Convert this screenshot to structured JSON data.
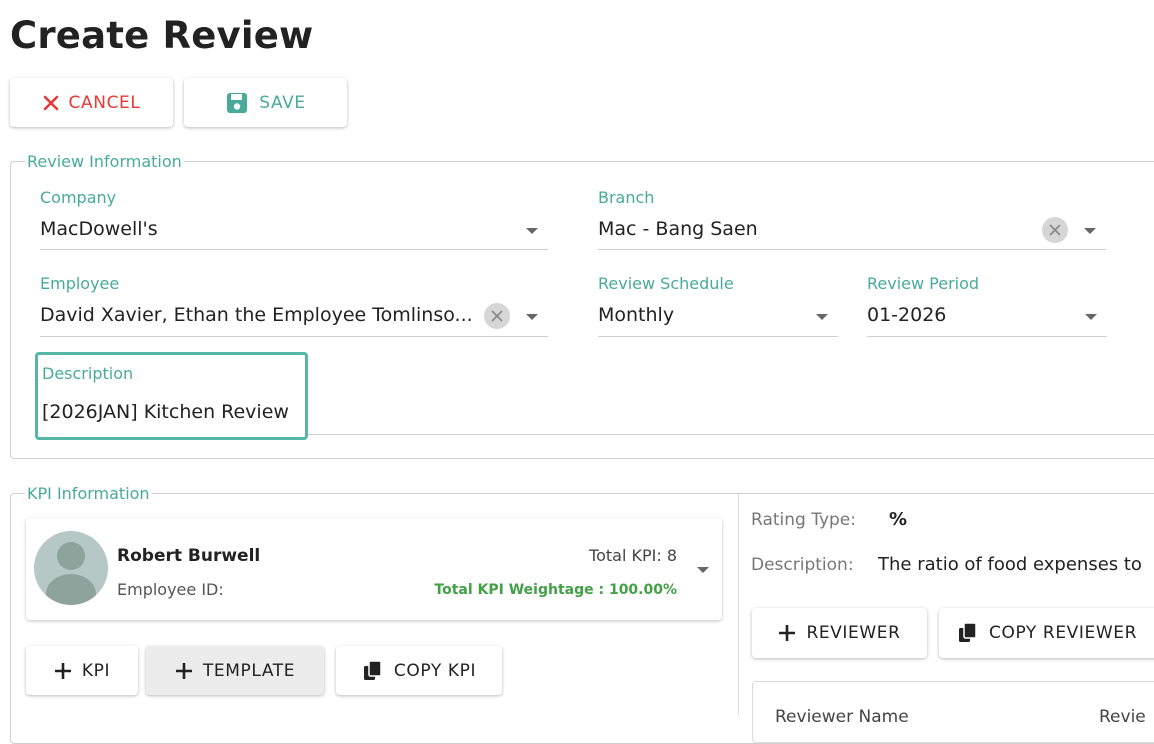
{
  "page": {
    "title": "Create Review"
  },
  "toolbar": {
    "cancel_label": "CANCEL",
    "save_label": "SAVE"
  },
  "review_info": {
    "legend": "Review Information",
    "company": {
      "label": "Company",
      "value": "MacDowell's"
    },
    "branch": {
      "label": "Branch",
      "value": "Mac - Bang Saen"
    },
    "employee": {
      "label": "Employee",
      "value": "David Xavier, Ethan the Employee Tomlinso..."
    },
    "schedule": {
      "label": "Review Schedule",
      "value": "Monthly"
    },
    "period": {
      "label": "Review Period",
      "value": "01-2026"
    },
    "description": {
      "label": "Description",
      "value": "[2026JAN] Kitchen Review"
    }
  },
  "kpi_info": {
    "legend": "KPI Information",
    "employee_card": {
      "name": "Robert Burwell",
      "id_label": "Employee ID:",
      "total_kpi": "Total KPI: 8",
      "total_weightage": "Total KPI Weightage : 100.00%"
    },
    "buttons": {
      "kpi": "KPI",
      "template": "TEMPLATE",
      "copy_kpi": "COPY KPI"
    },
    "detail": {
      "rating_type_label": "Rating Type:",
      "rating_type_value": "%",
      "description_label": "Description:",
      "description_value": "The ratio of food expenses to",
      "add_reviewer": "REVIEWER",
      "copy_reviewer": "COPY REVIEWER",
      "table_header": "Reviewer Name",
      "table_header_2": "Revie"
    }
  },
  "colors": {
    "accent": "#48ab9a",
    "danger": "#e53935",
    "success": "#43a047"
  },
  "icons": {
    "cancel": "close-icon",
    "save": "floppy-disk-icon",
    "add": "plus-icon",
    "copy": "copy-icon"
  }
}
